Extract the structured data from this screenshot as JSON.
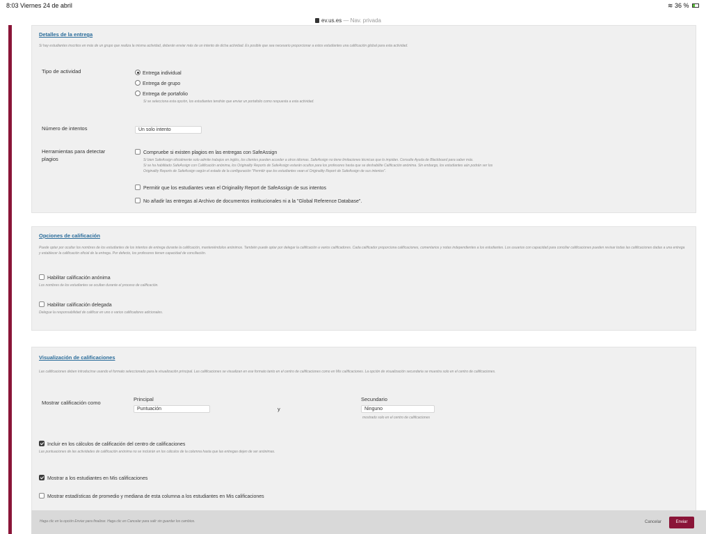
{
  "status": {
    "time": "8:03",
    "date": "Viernes 24 de abril",
    "url": "ev.us.es",
    "private_mode": "— Nav. privada",
    "battery": "36 %"
  },
  "delivery": {
    "title": "Detalles de la entrega",
    "description": "Si hay estudiantes inscritos en más de un grupo que realiza la misma actividad, deberán enviar más de un intento de dicha actividad. Es posible que sea necesario proporcionar a estos estudiantes una calificación global para esta actividad.",
    "activity_type_label": "Tipo de actividad",
    "activity_options": [
      "Entrega individual",
      "Entrega de grupo",
      "Entrega de portafolio"
    ],
    "portfolio_note": "Si se selecciona esta opción, los estudiantes tendrán que enviar un portafolio como respuesta a esta actividad.",
    "attempts_label": "Número de intentos",
    "attempts_value": "Un solo intento",
    "plagiarism_label": "Herramientas para detectar plagios",
    "safeassign_check": "Compruebe si existen plagios en las entregas con SafeAssign",
    "safeassign_note_1": "Si bien SafeAssign oficialmente solo admite trabajos en inglés, los clientes pueden acceder a otros idiomas. SafeAssign no tiene limitaciones técnicas que lo impidan. Consulte Ayuda de Blackboard para saber más.",
    "safeassign_note_2": "Si se ha habilitado SafeAssign con Calificación anónima, los Originality Reports de SafeAssign estarán ocultos para los profesores hasta que se deshabilite Calificación anónima. Sin embargo, los estudiantes aún podrán ver los",
    "safeassign_note_3": "Originality Reports de SafeAssign según el estado de la configuración \"Permitir que los estudiantes vean el Originality Report de SafeAssign de sus intentos\".",
    "allow_view_report": "Permitir que los estudiantes vean el Originality Report de SafeAssign de sus intentos",
    "no_global_db": "No añadir las entregas al Archivo de documentos institucionales ni a la \"Global Reference Database\"."
  },
  "grading": {
    "title": "Opciones de calificación",
    "description": "Puede optar por ocultar los nombres de los estudiantes de los intentos de entrega durante la calificación, manteniéndolos anónimos. También puede optar por delegar la calificación a varios calificadores. Cada calificador proporciona calificaciones, comentarios y notas independientes a los estudiantes. Los usuarios con capacidad para conciliar calificaciones pueden revisar todas las calificaciones dadas a una entrega y establecer la calificación oficial de la entrega. Por defecto, los profesores tienen capacidad de conciliación.",
    "anonymous_label": "Habilitar calificación anónima",
    "anonymous_note": "Los nombres de los estudiantes se ocultan durante el proceso de calificación.",
    "delegated_label": "Habilitar calificación delegada",
    "delegated_note": "Delegue la responsabilidad de calificar en uno o varios calificadores adicionales."
  },
  "display": {
    "title": "Visualización de calificaciones",
    "description": "Las calificaciones deben introducirse usando el formato seleccionado para la visualización principal. Las calificaciones se visualizan en ese formato tanto en el centro de calificaciones como en Mis calificaciones. La opción de visualización secundaria se muestra solo en el centro de calificaciones.",
    "show_as_label": "Mostrar calificación como",
    "primary_label": "Principal",
    "primary_value": "Puntuación",
    "connector": "y",
    "secondary_label": "Secundario",
    "secondary_value": "Ninguno",
    "secondary_note": "mostrado solo en el centro de calificaciones",
    "include_calc": "Incluir en los cálculos de calificación del centro de calificaciones",
    "include_calc_note": "Las puntuaciones de las actividades de calificación anónima no se incluirán en los cálculos de la columna hasta que las entregas dejen de ser anónimas.",
    "show_students": "Mostrar a los estudiantes en Mis calificaciones",
    "show_stats": "Mostrar estadísticas de promedio y mediana de esta columna a los estudiantes en Mis calificaciones"
  },
  "footer": {
    "hint": "Haga clic en la opción Enviar para finalizar. Haga clic en Cancelar para salir sin guardar los cambios.",
    "cancel": "Cancelar",
    "submit": "Enviar"
  }
}
